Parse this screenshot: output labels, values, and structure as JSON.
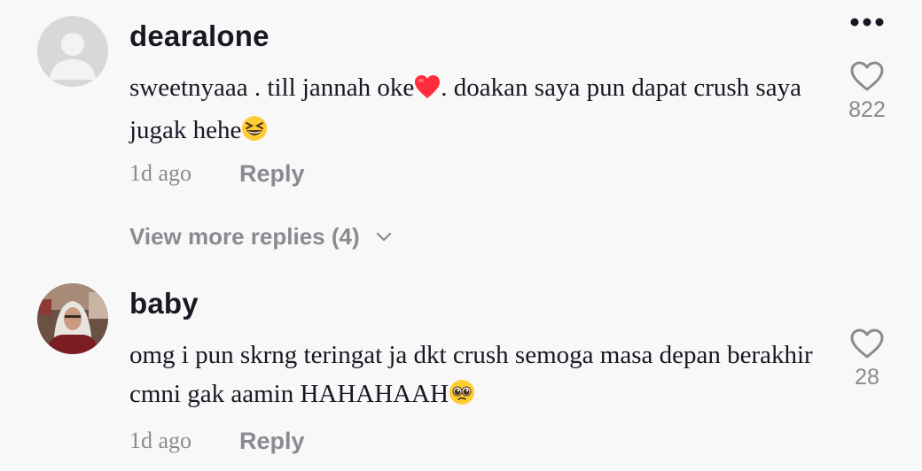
{
  "comments": [
    {
      "username": "dearalone",
      "text_part1": "sweetnyaaa . till jannah oke",
      "text_part2": ". doakan saya pun dapat crush saya jugak hehe",
      "time": "1d ago",
      "reply_label": "Reply",
      "likes": "822",
      "emoji1": "red-heart",
      "emoji2": "grinning-squinting-face"
    },
    {
      "username": "baby",
      "text_part1": "omg i pun skrng teringat ja dkt crush semoga masa depan berakhir cmni gak aamin HAHAHAAH",
      "time": "1d ago",
      "reply_label": "Reply",
      "likes": "28",
      "emoji1": "pleading-face"
    }
  ],
  "view_more": {
    "label": "View more replies (4)"
  },
  "colors": {
    "background": "#f8f8f8",
    "primary_text": "#161823",
    "secondary_text": "#8a8b91",
    "heart_red": "#ff2c3c",
    "emoji_yellow": "#ffcc33"
  }
}
